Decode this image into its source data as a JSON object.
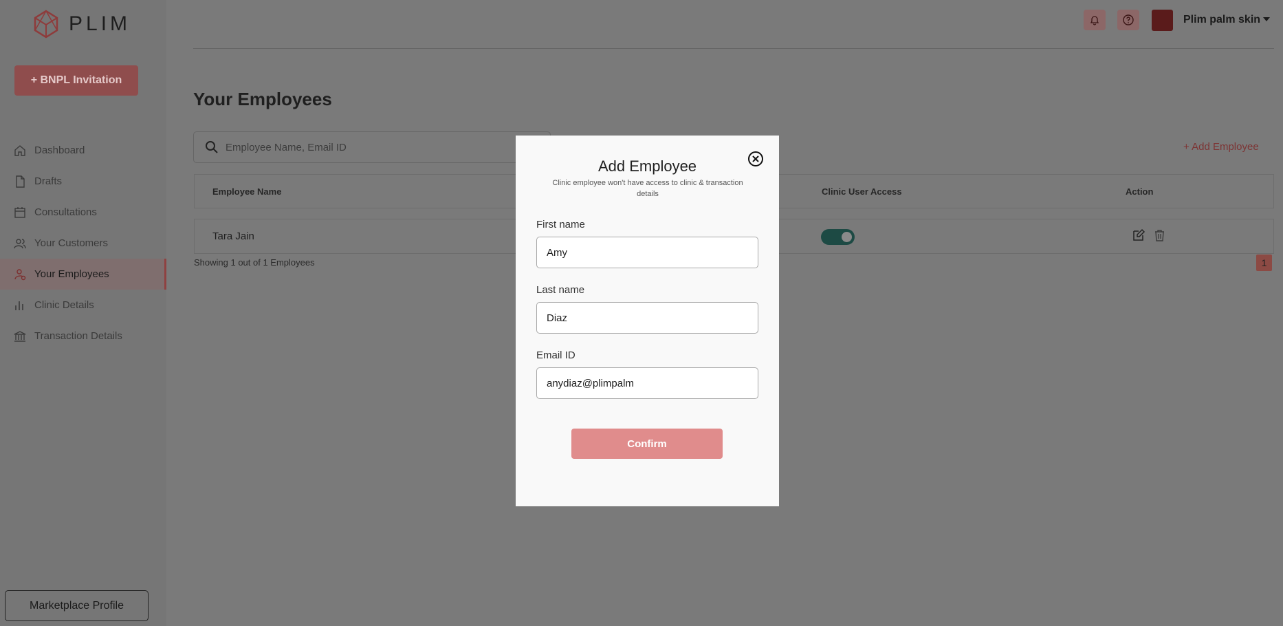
{
  "brand": {
    "name": "PLIM"
  },
  "sidebar": {
    "cta_label": "+ BNPL Invitation",
    "items": [
      {
        "label": "Dashboard",
        "icon": "home-icon"
      },
      {
        "label": "Drafts",
        "icon": "file-icon"
      },
      {
        "label": "Consultations",
        "icon": "calendar-icon"
      },
      {
        "label": "Your Customers",
        "icon": "users-icon"
      },
      {
        "label": "Your Employees",
        "icon": "employee-icon",
        "active": true
      },
      {
        "label": "Clinic Details",
        "icon": "bar-chart-icon"
      },
      {
        "label": "Transaction Details",
        "icon": "bank-icon"
      }
    ],
    "marketplace_label": "Marketplace Profile"
  },
  "header": {
    "user_name": "Plim palm skin",
    "icons": [
      "bell-icon",
      "help-icon",
      "avatar"
    ]
  },
  "main": {
    "title": "Your Employees",
    "search_placeholder": "Employee Name, Email ID",
    "add_employee_label": "+ Add Employee",
    "table": {
      "columns": [
        "Employee Name",
        "Clinic User Access",
        "Action"
      ],
      "rows": [
        {
          "name": "Tara Jain",
          "access_enabled": true
        }
      ]
    },
    "showing_text": "Showing 1 out of 1 Employees",
    "current_page": "1"
  },
  "modal": {
    "title": "Add Employee",
    "subtitle": "Clinic employee won't have access to clinic & transaction details",
    "first_name_label": "First name",
    "first_name_value": "Amy",
    "last_name_label": "Last name",
    "last_name_value": "Diaz",
    "email_label": "Email ID",
    "email_value": "anydiaz@plimpalm",
    "confirm_label": "Confirm"
  },
  "colors": {
    "accent": "#e08c8c",
    "brand": "#c25656",
    "toggle_on": "#1d4a44"
  }
}
